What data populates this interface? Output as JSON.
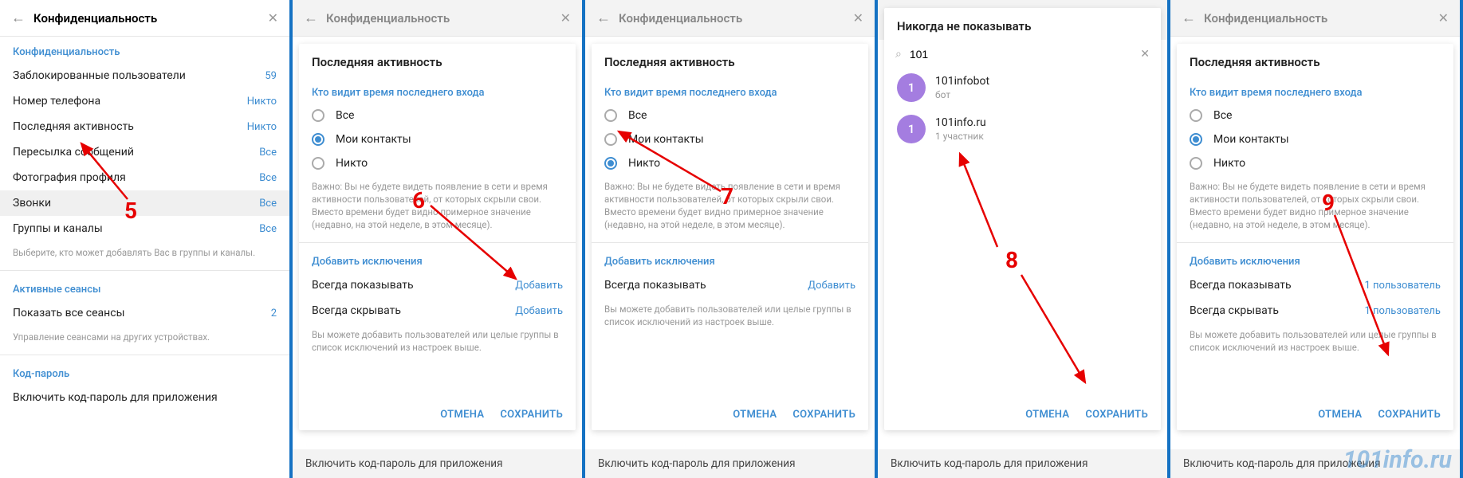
{
  "common": {
    "privacy_title": "Конфиденциальность",
    "lastseen_title": "Последняя активность",
    "who_sees": "Кто видит время последнего входа",
    "opt_all": "Все",
    "opt_contacts": "Мои контакты",
    "opt_nobody": "Никто",
    "note": "Важно: Вы не будете видеть появление в сети и время активности пользователей, от которых скрыли свои. Вместо времени будет видно примерное значение (недавно, на этой неделе, в этом месяце).",
    "add_exc": "Добавить исключения",
    "always_show": "Всегда показывать",
    "always_hide": "Всегда скрывать",
    "add": "Добавить",
    "exc_hint": "Вы можете добавить пользователей или целые группы в список исключений из настроек выше.",
    "cancel": "ОТМЕНА",
    "save": "СОХРАНИТЬ",
    "enable_passcode": "Включить код-пароль для приложения",
    "one_user": "1 пользователь"
  },
  "p1": {
    "section": "Конфиденциальность",
    "rows": [
      {
        "l": "Заблокированные пользователи",
        "v": "59"
      },
      {
        "l": "Номер телефона",
        "v": "Никто"
      },
      {
        "l": "Последняя активность",
        "v": "Никто"
      },
      {
        "l": "Пересылка сообщений",
        "v": "Все"
      },
      {
        "l": "Фотография профиля",
        "v": "Все"
      },
      {
        "l": "Звонки",
        "v": "Все"
      },
      {
        "l": "Группы и каналы",
        "v": "Все"
      }
    ],
    "rows_hint": "Выберите, кто может добавлять Вас в группы и каналы.",
    "sessions": "Активные сеансы",
    "show_all": "Показать все сеансы",
    "sess_count": "2",
    "sess_hint": "Управление сеансами на других устройствах.",
    "passcode": "Код-пароль"
  },
  "p4": {
    "never_show": "Никогда не показывать",
    "query": "101",
    "r1": {
      "name": "101infobot",
      "sub": "бот",
      "initial": "1"
    },
    "r2": {
      "name": "101info.ru",
      "sub": "1 участник",
      "initial": "1"
    }
  },
  "anno": {
    "n5": "5",
    "n6": "6",
    "n7": "7",
    "n8": "8",
    "n9": "9"
  },
  "watermark": "101info.ru"
}
